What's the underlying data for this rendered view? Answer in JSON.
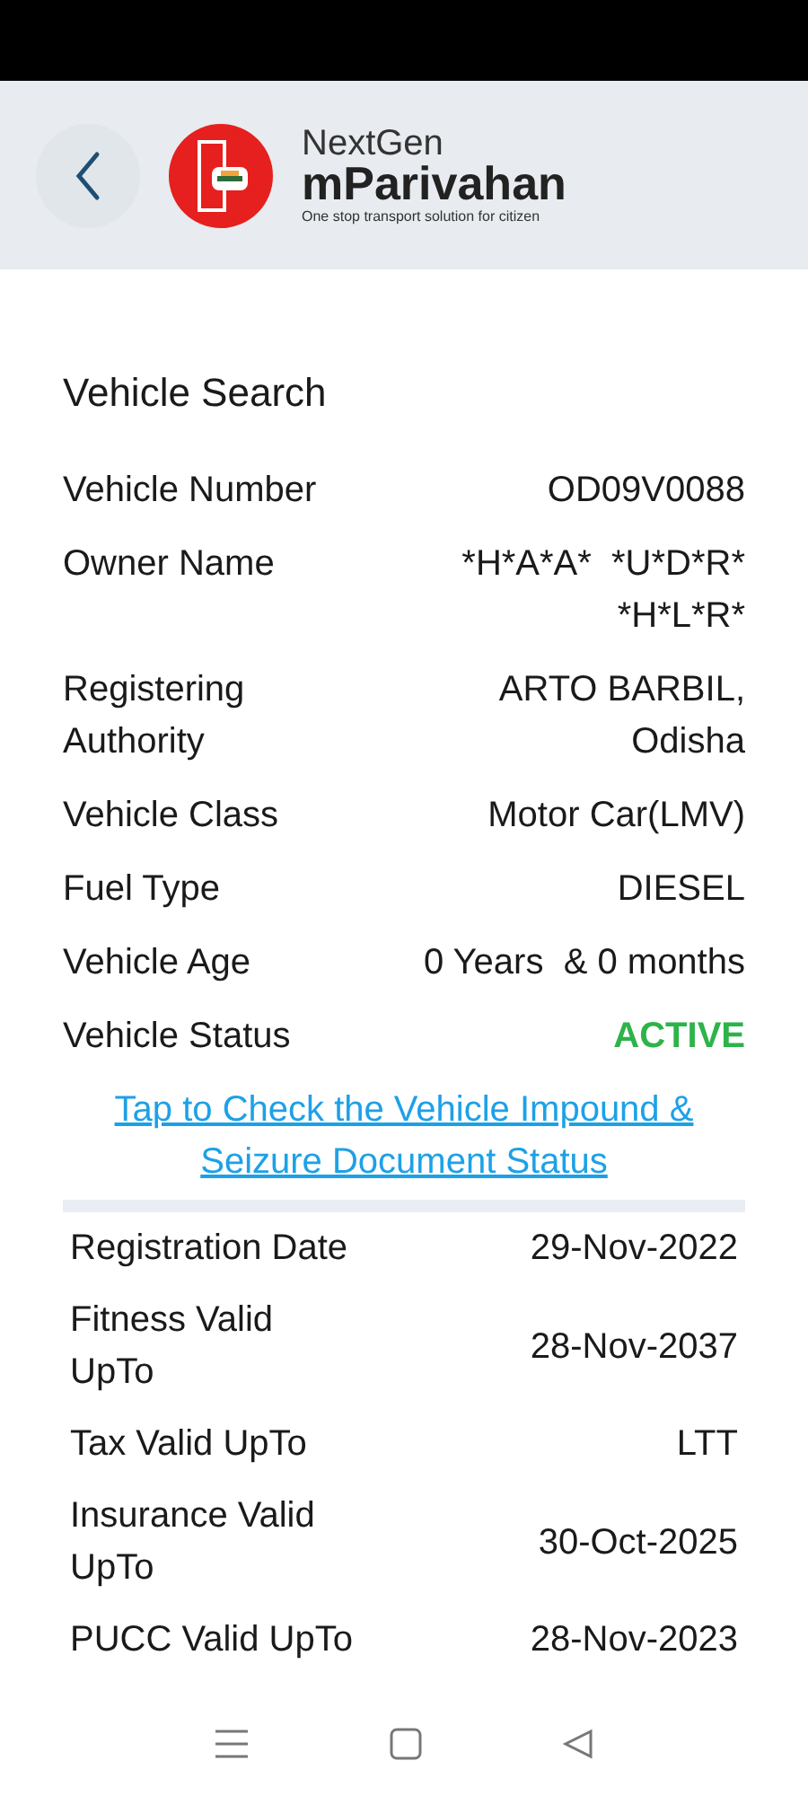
{
  "header": {
    "brand_top": "NextGen",
    "brand_name": "mParivahan",
    "tagline": "One stop transport solution for citizen"
  },
  "title": "Vehicle Search",
  "details": [
    {
      "label": "Vehicle Number",
      "value": "OD09V0088",
      "kind": "text"
    },
    {
      "label": "Owner Name",
      "value": "*H*A*A*  *U*D*R*  *H*L*R*",
      "kind": "text"
    },
    {
      "label": "Registering Authority",
      "value": "ARTO BARBIL, Odisha",
      "kind": "text"
    },
    {
      "label": "Vehicle Class",
      "value": "Motor Car(LMV)",
      "kind": "text"
    },
    {
      "label": "Fuel Type",
      "value": "DIESEL",
      "kind": "text"
    },
    {
      "label": "Vehicle Age",
      "value": "0 Years  & 0 months",
      "kind": "text"
    },
    {
      "label": "Vehicle Status",
      "value": "ACTIVE",
      "kind": "status"
    }
  ],
  "link": "Tap to Check the Vehicle Impound & Seizure Document Status",
  "validity": [
    {
      "label": "Registration Date",
      "value": "29-Nov-2022"
    },
    {
      "label": "Fitness Valid UpTo",
      "value": "28-Nov-2037"
    },
    {
      "label": "Tax Valid UpTo",
      "value": "LTT"
    },
    {
      "label": "Insurance Valid UpTo",
      "value": "30-Oct-2025"
    },
    {
      "label": "PUCC Valid UpTo",
      "value": "28-Nov-2023"
    }
  ]
}
